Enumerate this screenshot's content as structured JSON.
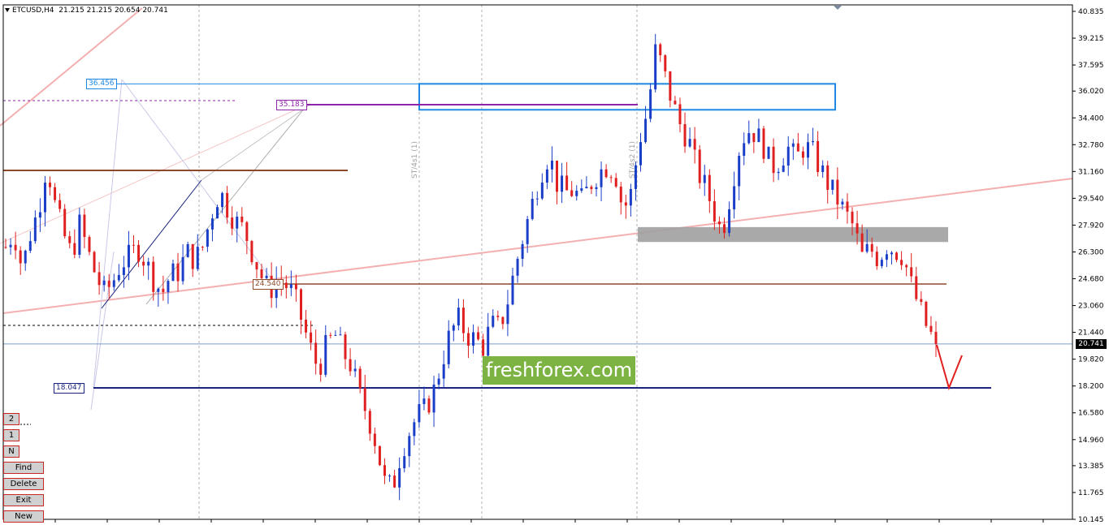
{
  "header": {
    "symbol": "ETCUSD,H4",
    "ohlc": "21.215 21.215 20.654 20.741"
  },
  "labels": {
    "upper_top": "36.456",
    "upper_mid": "35.183",
    "lower": "18.047",
    "middle": "24.540",
    "current": "20.741"
  },
  "brand": {
    "text": "freshforex.com",
    "color": "#7cb342"
  },
  "buttons": {
    "b2": "2",
    "b1": "1",
    "bn": "N",
    "find": "Find",
    "delete": "Delete",
    "exit": "Exit",
    "new": "New"
  },
  "colors": {
    "bull": "#1a3ec8",
    "bear": "#e02020",
    "support": "#1a237e",
    "resistance": "#8d4a2b",
    "trend": "#f4b0b0",
    "zone_blue": "#1e88e5",
    "zone_gray": "#a0a0a0"
  },
  "chart_data": {
    "type": "candlestick",
    "symbol": "ETCUSD",
    "timeframe": "H4",
    "y_axis_ticks": [
      40.835,
      39.215,
      37.595,
      36.02,
      34.4,
      32.78,
      31.16,
      29.54,
      27.92,
      26.3,
      24.68,
      23.06,
      21.44,
      19.82,
      18.2,
      16.58,
      14.96,
      13.385,
      11.765,
      10.145
    ],
    "ylim": [
      10.145,
      40.835
    ],
    "current_price": 20.741,
    "levels": [
      {
        "name": "upper-zone-top",
        "value": 36.456
      },
      {
        "name": "upper-zone-bottom",
        "value": 35.183
      },
      {
        "name": "resistance-upper",
        "value": 31.3
      },
      {
        "name": "middle",
        "value": 24.54
      },
      {
        "name": "support",
        "value": 18.047
      }
    ],
    "grey_zone": [
      26.9,
      27.8
    ],
    "vertical_markers": [
      "ST/4s1 (1)",
      "ST/4s2 (1)"
    ],
    "close_path": [
      26.6,
      27.5,
      25.3,
      27.4,
      28.9,
      31.7,
      29.1,
      27.4,
      26.1,
      28.0,
      26.3,
      24.8,
      23.8,
      24.5,
      25.6,
      26.0,
      26.6,
      25.7,
      24.6,
      23.8,
      24.9,
      25.1,
      26.3,
      25.8,
      26.7,
      28.6,
      30.0,
      28.9,
      28.1,
      27.6,
      26.2,
      24.9,
      23.9,
      24.7,
      24.3,
      23.7,
      22.1,
      20.5,
      19.2,
      20.7,
      21.3,
      20.2,
      19.4,
      17.6,
      16.4,
      14.7,
      12.4,
      12.0,
      14.2,
      15.4,
      16.4,
      16.8,
      17.9,
      19.7,
      21.4,
      22.2,
      21.3,
      21.0,
      20.6,
      21.9,
      21.7,
      23.4,
      25.6,
      27.5,
      29.3,
      31.1,
      32.2,
      30.4,
      29.9,
      30.0,
      29.4,
      30.4,
      31.1,
      31.5,
      31.2,
      28.8,
      29.9,
      33.1,
      34.9,
      38.7,
      37.0,
      35.3,
      33.9,
      33.0,
      31.2,
      30.2,
      28.8,
      27.4,
      29.8,
      32.4,
      33.7,
      33.5,
      32.8,
      31.4,
      31.8,
      32.6,
      31.9,
      32.7,
      32.3,
      31.3,
      30.3,
      29.5,
      28.6,
      27.8,
      26.0,
      26.5,
      25.9,
      26.7,
      26.4,
      26.1,
      24.3,
      22.9,
      21.6,
      20.741
    ]
  }
}
